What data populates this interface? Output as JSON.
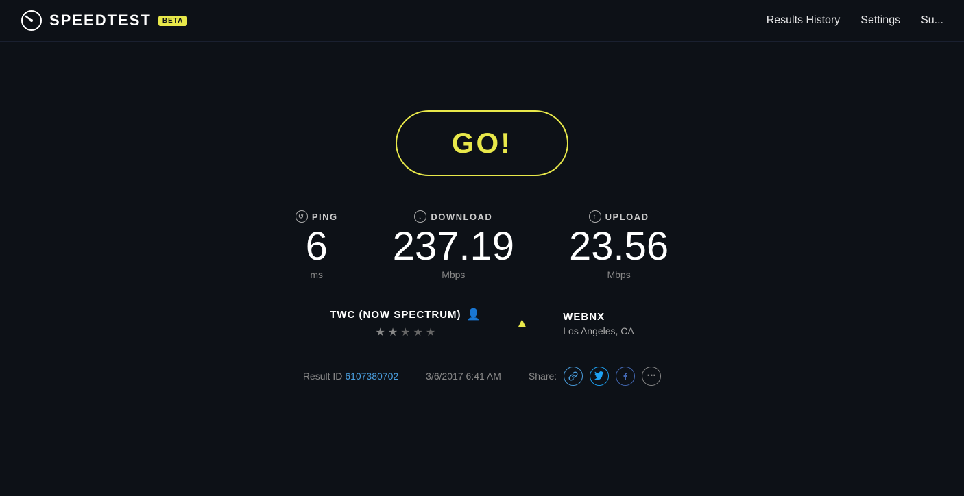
{
  "header": {
    "logo_text": "SPEEDTEST",
    "beta_label": "BETA",
    "nav": {
      "results_history": "Results History",
      "settings": "Settings",
      "support": "Su..."
    }
  },
  "main": {
    "go_button_label": "GO!",
    "stats": [
      {
        "id": "ping",
        "icon_label": "ping-icon",
        "label": "PING",
        "value": "6",
        "unit": "ms"
      },
      {
        "id": "download",
        "icon_label": "download-icon",
        "label": "DOWNLOAD",
        "value": "237.19",
        "unit": "Mbps"
      },
      {
        "id": "upload",
        "icon_label": "upload-icon",
        "label": "UPLOAD",
        "value": "23.56",
        "unit": "Mbps"
      }
    ],
    "provider": {
      "name": "TWC (NOW SPECTRUM)",
      "stars": [
        true,
        true,
        false,
        false,
        false
      ]
    },
    "server": {
      "name": "WEBNX",
      "location": "Los Angeles, CA"
    },
    "result": {
      "id_label": "Result ID",
      "id_value": "6107380702",
      "date": "3/6/2017 6:41 AM",
      "share_label": "Share:"
    }
  },
  "icons": {
    "ping": "↺",
    "download": "↓",
    "upload": "↑",
    "link": "🔗",
    "twitter": "t",
    "facebook": "f",
    "more": "···",
    "server": "▲",
    "person": "👤"
  }
}
